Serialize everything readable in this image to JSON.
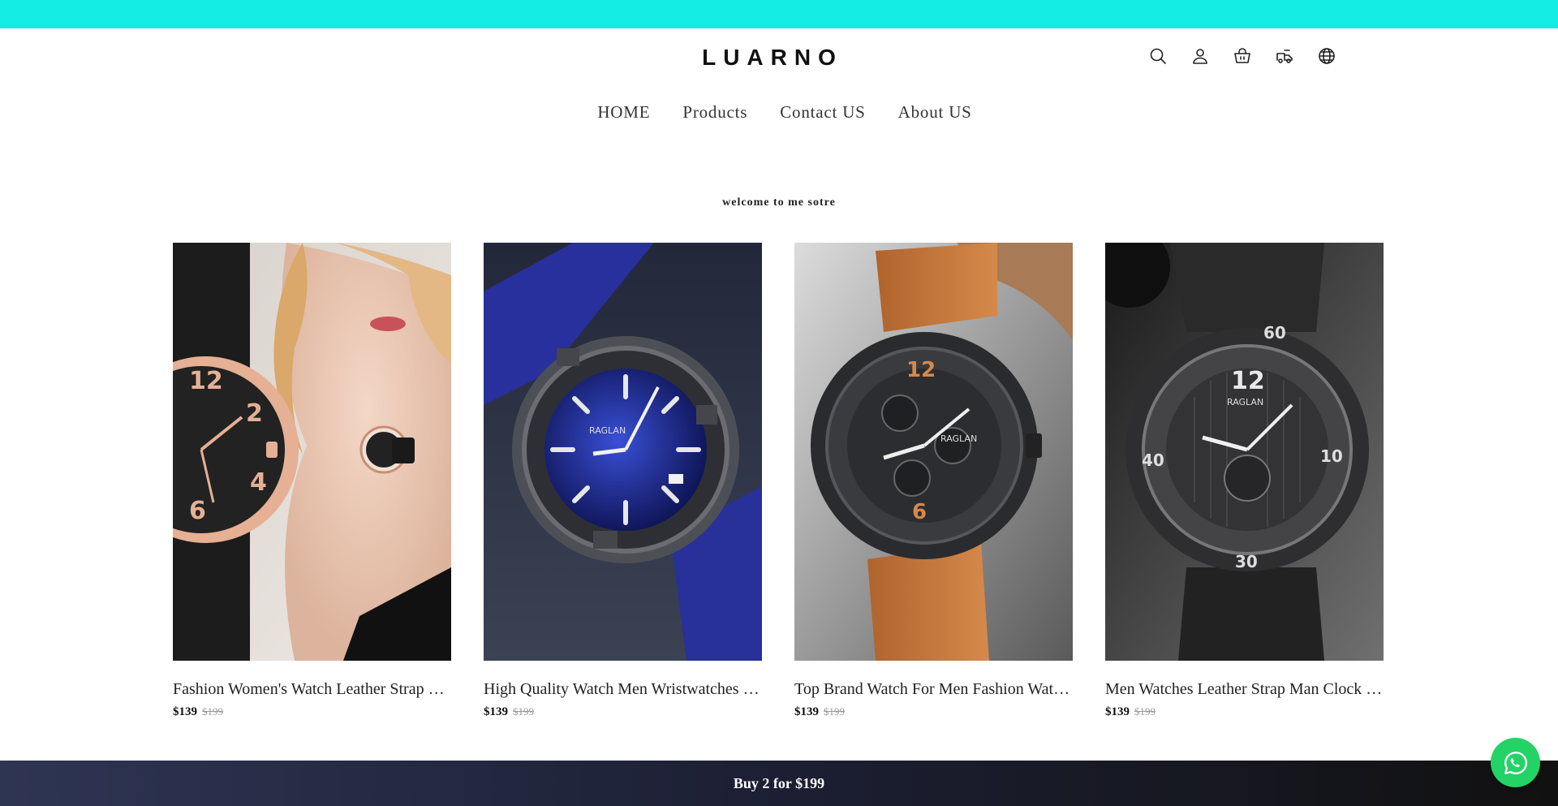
{
  "brand": {
    "logo": "LUARNO",
    "accent_color": "#14ede3"
  },
  "header_icons": [
    "search-icon",
    "account-icon",
    "cart-icon",
    "order-tracking-icon",
    "language-icon"
  ],
  "nav": {
    "items": [
      "HOME",
      "Products",
      "Contact US",
      "About US"
    ]
  },
  "welcome": "welcome to me sotre",
  "products": [
    {
      "title": "Fashion Women's Watch Leather Strap Quartz Wristwatch",
      "price": "$139",
      "compare_price": "$199",
      "image": "rose-gold-womens-watch"
    },
    {
      "title": "High Quality Watch Men Wristwatches Quartz Blue",
      "price": "$139",
      "compare_price": "$199",
      "image": "blue-dial-mens-watch"
    },
    {
      "title": "Top Brand Watch For Men Fashion Watches Chronograph",
      "price": "$139",
      "compare_price": "$199",
      "image": "brown-strap-chronograph"
    },
    {
      "title": "Men Watches Leather Strap Man Clock Sport",
      "price": "$139",
      "compare_price": "$199",
      "image": "black-chronograph-watch"
    }
  ],
  "promo_bar": "Buy 2 for $199",
  "whatsapp_color": "#23d366"
}
